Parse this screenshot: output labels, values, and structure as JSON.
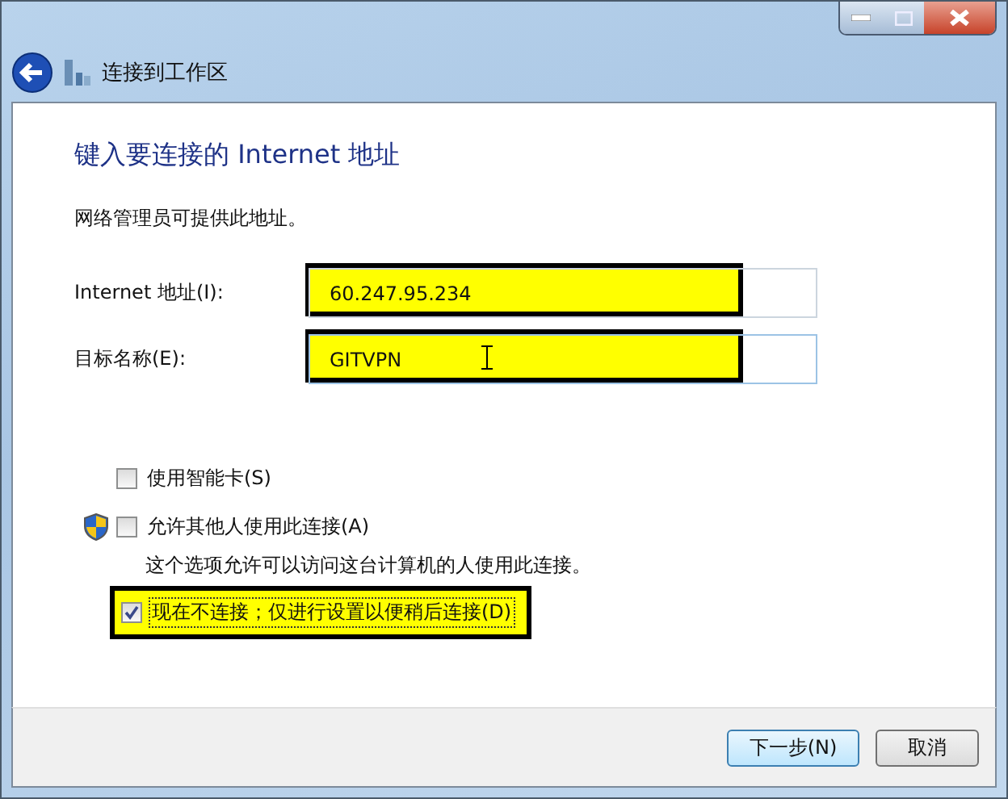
{
  "window": {
    "title": "连接到工作区"
  },
  "heading": "键入要连接的 Internet 地址",
  "description": "网络管理员可提供此地址。",
  "fields": [
    {
      "label": "Internet 地址(I):",
      "value": "60.247.95.234",
      "highlighted": true,
      "text_cursor": false
    },
    {
      "label": "目标名称(E):",
      "value": "GITVPN",
      "highlighted": true,
      "text_cursor": true
    }
  ],
  "options": [
    {
      "label": "使用智能卡(S)",
      "checked": false,
      "shield": false,
      "highlighted": false,
      "focused": false
    },
    {
      "label": "允许其他人使用此连接(A)",
      "checked": false,
      "shield": true,
      "highlighted": false,
      "focused": false,
      "note": "这个选项允许可以访问这台计算机的人使用此连接。"
    },
    {
      "label": "现在不连接；仅进行设置以便稍后连接(D)",
      "checked": true,
      "shield": false,
      "highlighted": true,
      "focused": true
    }
  ],
  "buttons": [
    {
      "label": "下一步(N)",
      "default": true
    },
    {
      "label": "取消",
      "default": false
    }
  ]
}
